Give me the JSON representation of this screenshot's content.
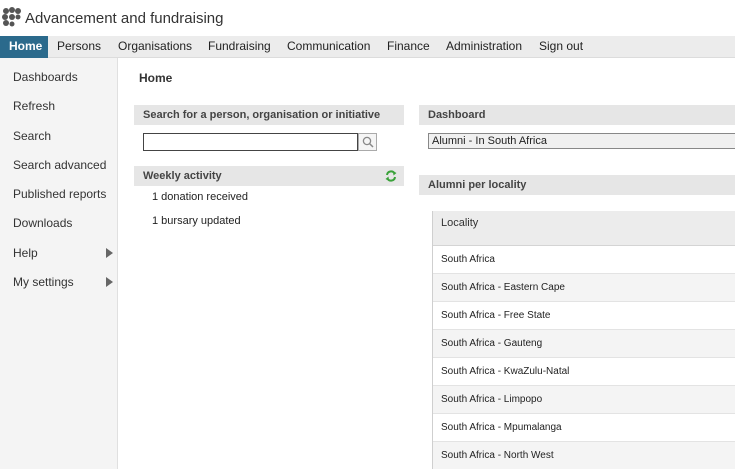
{
  "app": {
    "title": "Advancement and fundraising"
  },
  "topnav": [
    {
      "label": "Home",
      "active": true
    },
    {
      "label": "Persons"
    },
    {
      "label": "Organisations"
    },
    {
      "label": "Fundraising"
    },
    {
      "label": "Communication"
    },
    {
      "label": "Finance"
    },
    {
      "label": "Administration"
    },
    {
      "label": "Sign out"
    }
  ],
  "sidebar": {
    "items": [
      {
        "label": "Dashboards"
      },
      {
        "label": "Refresh"
      },
      {
        "label": "Search"
      },
      {
        "label": "Search advanced"
      },
      {
        "label": "Published reports"
      },
      {
        "label": "Downloads"
      },
      {
        "label": "Help",
        "submenu": true
      },
      {
        "label": "My settings",
        "submenu": true
      }
    ]
  },
  "main": {
    "title": "Home",
    "search_panel": {
      "heading": "Search for a person, organisation or initiative",
      "value": ""
    },
    "activity_panel": {
      "heading": "Weekly activity",
      "items": [
        "1 donation received",
        "1 bursary updated"
      ]
    },
    "dashboard_panel": {
      "heading": "Dashboard",
      "selected": "Alumni - In South Africa"
    },
    "locality_panel": {
      "heading": "Alumni per locality",
      "column": "Locality",
      "rows": [
        "South Africa",
        "South Africa - Eastern Cape",
        "South Africa - Free State",
        "South Africa - Gauteng",
        "South Africa - KwaZulu-Natal",
        "South Africa - Limpopo",
        "South Africa - Mpumalanga",
        "South Africa - North West"
      ]
    }
  },
  "colors": {
    "nav_active": "#2b6a8c",
    "refresh_green": "#3aa23a"
  },
  "icons": {
    "logo": "app-logo-icon",
    "search": "search-icon",
    "refresh": "refresh-icon",
    "submenu": "chevron-right-icon"
  }
}
